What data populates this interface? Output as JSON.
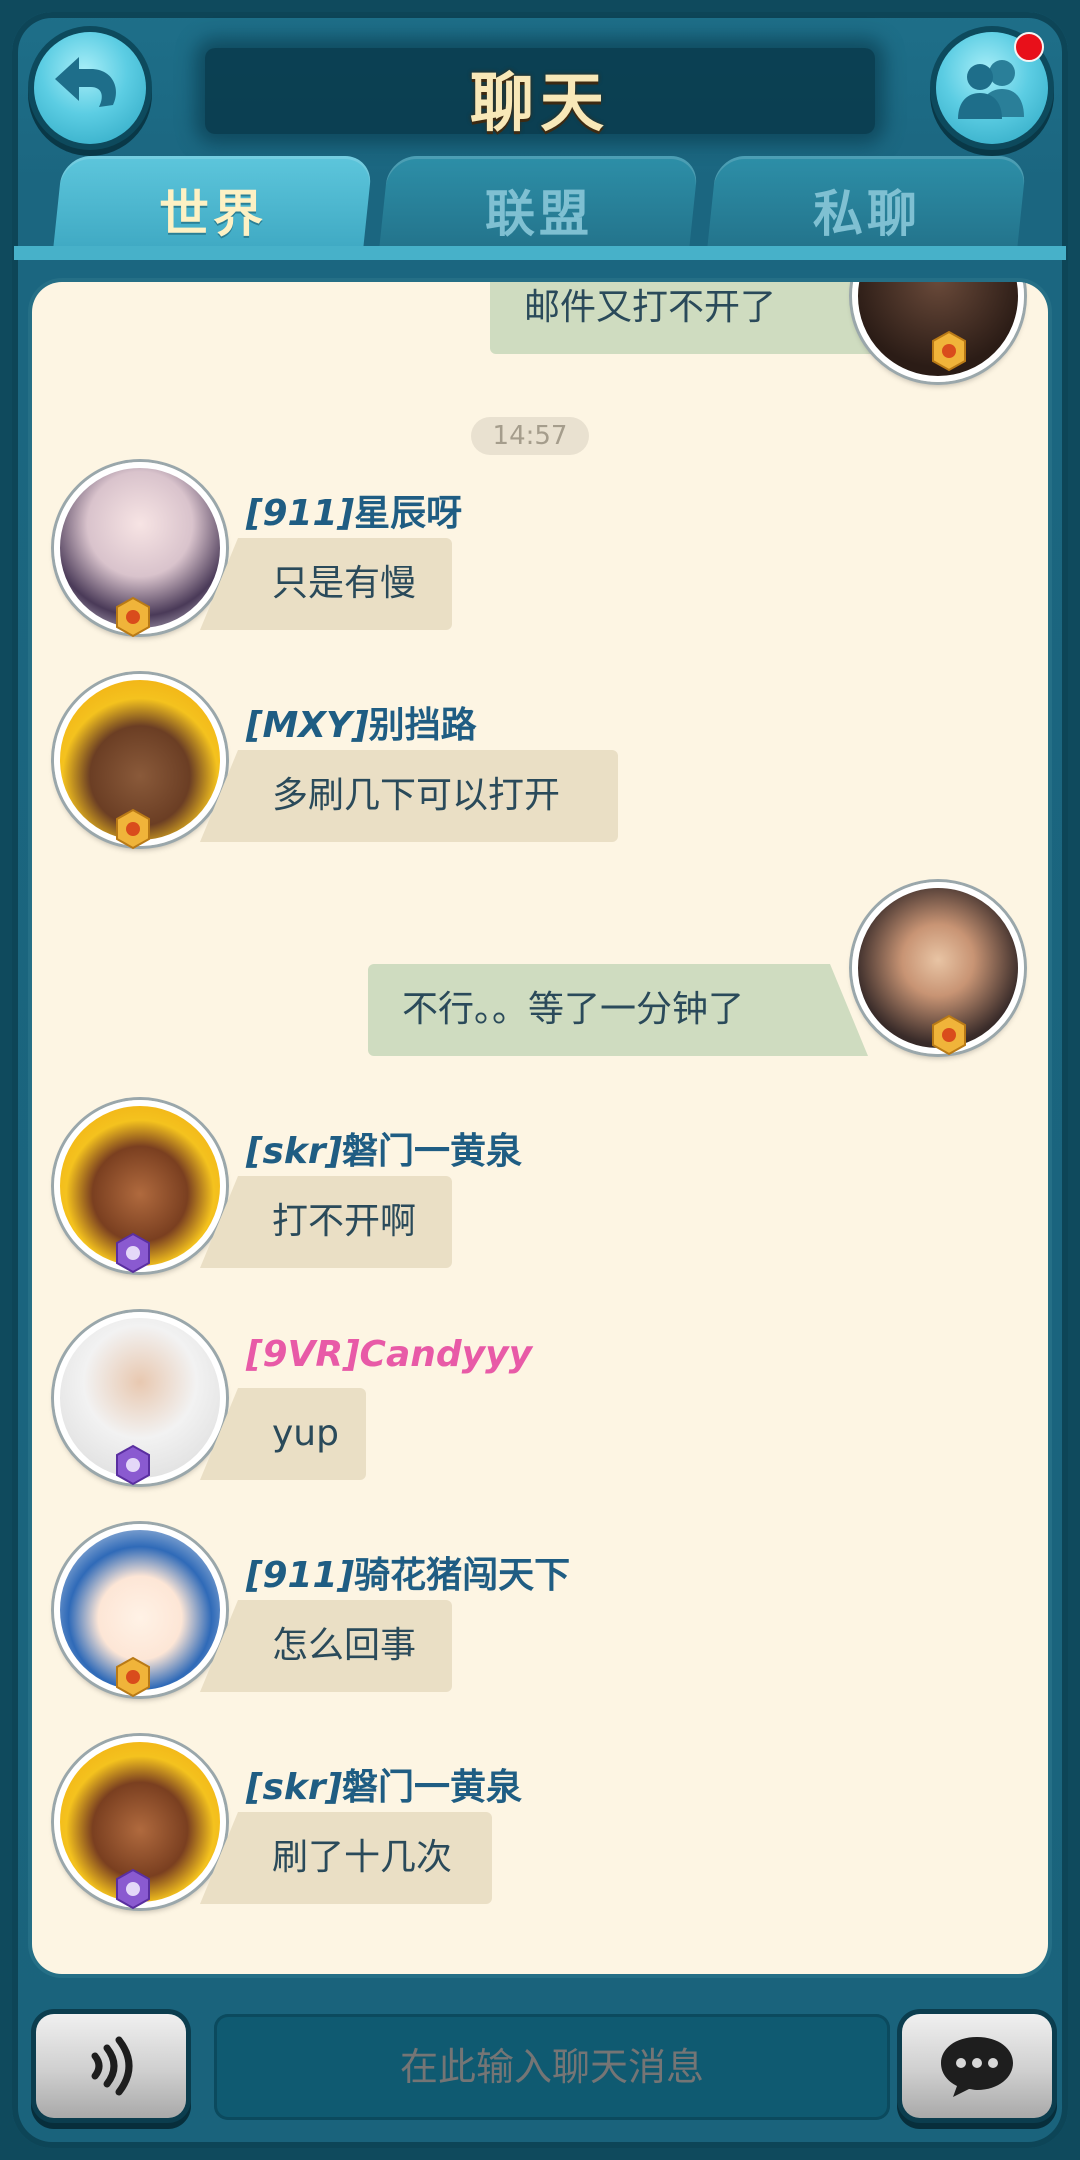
{
  "header": {
    "title": "聊天"
  },
  "tabs": [
    {
      "label": "世界",
      "active": true
    },
    {
      "label": "联盟",
      "active": false
    },
    {
      "label": "私聊",
      "active": false
    }
  ],
  "chat": {
    "top_partial_message": "邮件又打不开了",
    "timestamp": "14:57",
    "messages": [
      {
        "tag": "[911]",
        "name": "星辰呀",
        "text": "只是有慢",
        "side": "in"
      },
      {
        "tag": "[MXY]",
        "name": "别挡路",
        "text": "多刷几下可以打开",
        "side": "in"
      },
      {
        "text": "不行。。等了一分钟了",
        "side": "out"
      },
      {
        "tag": "[skr]",
        "name": "磐门一黄泉",
        "text": "打不开啊",
        "side": "in"
      },
      {
        "tag": "[9VR]",
        "name": "Candyyy",
        "text": "yup",
        "side": "in"
      },
      {
        "tag": "[911]",
        "name": "骑花猪闯天下",
        "text": "怎么回事",
        "side": "in"
      },
      {
        "tag": "[skr]",
        "name": "磐门一黄泉",
        "text": "刷了十几次",
        "side": "in"
      }
    ]
  },
  "input": {
    "placeholder": "在此输入聊天消息"
  },
  "colors": {
    "frame": "#1b6680",
    "panel": "#fdf5e3",
    "incoming_bubble": "#eadfc5",
    "outgoing_bubble": "#cfdcc0",
    "name": "#1f5d83",
    "name_highlight": "#e85aa7",
    "notification": "#e8101a"
  },
  "icons": {
    "back": "back-arrow-icon",
    "friends": "friends-icon",
    "voice": "voice-icon",
    "send": "chat-bubble-icon",
    "rank_gold": "gold-rank-badge-icon",
    "rank_purple": "purple-rank-badge-icon"
  }
}
